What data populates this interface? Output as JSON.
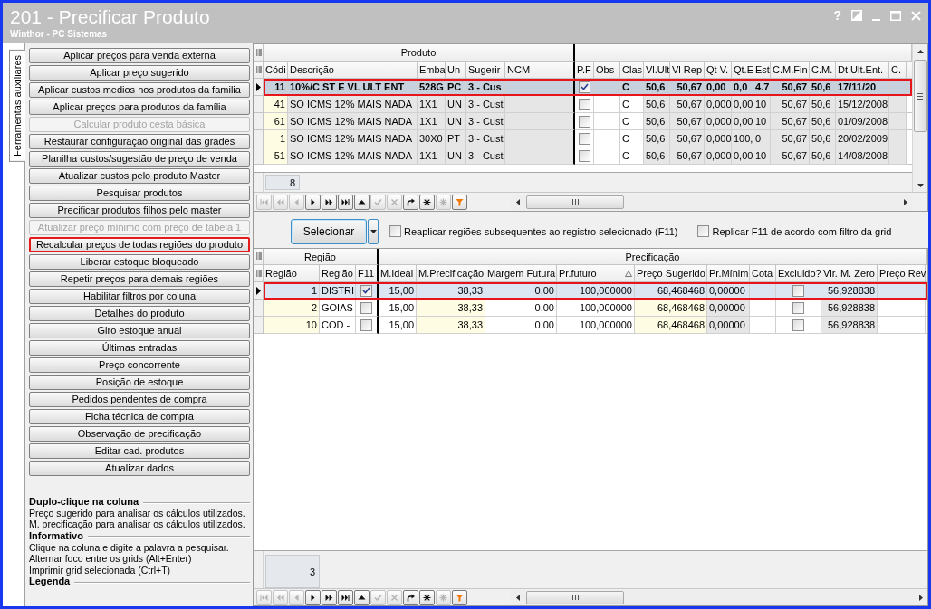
{
  "window": {
    "title": "201 - Precificar Produto",
    "subtitle": "Winthor - PC Sistemas",
    "help_label": "?"
  },
  "side_tab": {
    "label": "Ferramentas auxiliares",
    "selected": true
  },
  "actions": [
    {
      "label": "Aplicar preços para venda externa",
      "disabled": false,
      "highlighted": false
    },
    {
      "label": "Aplicar preço sugerido",
      "disabled": false,
      "highlighted": false
    },
    {
      "label": "Aplicar custos medios nos produtos da familia",
      "disabled": false,
      "highlighted": false
    },
    {
      "label": "Aplicar preços para produtos da família",
      "disabled": false,
      "highlighted": false
    },
    {
      "label": "Calcular produto cesta básica",
      "disabled": true,
      "highlighted": false
    },
    {
      "label": "Restaurar configuração original das grades",
      "disabled": false,
      "highlighted": false
    },
    {
      "label": "Planilha custos/sugestão de preço de venda",
      "disabled": false,
      "highlighted": false
    },
    {
      "label": "Atualizar custos pelo produto Master",
      "disabled": false,
      "highlighted": false
    },
    {
      "label": "Pesquisar produtos",
      "disabled": false,
      "highlighted": false
    },
    {
      "label": "Precificar produtos filhos pelo master",
      "disabled": false,
      "highlighted": false
    },
    {
      "label": "Atualizar preço mínimo com preço de tabela 1",
      "disabled": true,
      "highlighted": false
    },
    {
      "label": "Recalcular preços de todas regiões do produto",
      "disabled": false,
      "highlighted": true
    },
    {
      "label": "Liberar estoque bloqueado",
      "disabled": false,
      "highlighted": false
    },
    {
      "label": "Repetir preços para demais regiões",
      "disabled": false,
      "highlighted": false
    },
    {
      "label": "Habilitar filtros por coluna",
      "disabled": false,
      "highlighted": false
    },
    {
      "label": "Detalhes do produto",
      "disabled": false,
      "highlighted": false
    },
    {
      "label": "Giro estoque anual",
      "disabled": false,
      "highlighted": false
    },
    {
      "label": "Últimas entradas",
      "disabled": false,
      "highlighted": false
    },
    {
      "label": "Preço concorrente",
      "disabled": false,
      "highlighted": false
    },
    {
      "label": "Posição de estoque",
      "disabled": false,
      "highlighted": false
    },
    {
      "label": "Pedidos pendentes de compra",
      "disabled": false,
      "highlighted": false
    },
    {
      "label": "Ficha técnica de compra",
      "disabled": false,
      "highlighted": false
    },
    {
      "label": "Observação de precificação",
      "disabled": false,
      "highlighted": false
    },
    {
      "label": "Editar cad. produtos",
      "disabled": false,
      "highlighted": false
    },
    {
      "label": "Atualizar dados",
      "disabled": false,
      "highlighted": false
    }
  ],
  "hints": [
    {
      "heading": "Duplo-clique na coluna",
      "lines": [
        "Preço sugerido para analisar os cálculos utilizados.",
        "M. precificação para analisar os cálculos utilizados."
      ]
    },
    {
      "heading": "Informativo",
      "lines": [
        "Clique na coluna e digite a palavra a pesquisar.",
        "Alternar foco entre os grids (Alt+Enter)",
        "Imprimir grid selecionada (Ctrl+T)"
      ]
    },
    {
      "heading": "Legenda"
    }
  ],
  "product_grid": {
    "bands": [
      {
        "label": "Produto",
        "columns": [
          {
            "label": "Códi",
            "kind": "number"
          },
          {
            "label": "Descrição",
            "kind": "text"
          },
          {
            "label": "Emba",
            "kind": "text"
          },
          {
            "label": "Un",
            "kind": "text"
          },
          {
            "label": "Sugerir",
            "kind": "text"
          },
          {
            "label": "NCM",
            "kind": "text"
          }
        ]
      },
      {
        "columns": [
          {
            "label": "P.F",
            "kind": "check"
          },
          {
            "label": "Obs",
            "kind": "text"
          },
          {
            "label": "Clas",
            "kind": "text"
          },
          {
            "label": "Vl.Ult",
            "kind": "text"
          },
          {
            "label": "Vl Rep",
            "kind": "number"
          },
          {
            "label": "Qt V.",
            "kind": "text"
          },
          {
            "label": "Qt.E",
            "kind": "text"
          },
          {
            "label": "Est",
            "kind": "text"
          },
          {
            "label": "C.M.Fin",
            "kind": "number"
          },
          {
            "label": "C.M.",
            "kind": "text"
          },
          {
            "label": "Dt.Ult.Ent.",
            "kind": "text"
          },
          {
            "label": "C.",
            "kind": "text"
          }
        ]
      }
    ],
    "rows": [
      {
        "selected": true,
        "highlighted": true,
        "cells": [
          "11",
          "10%/C ST E VL ULT ENT",
          "528G",
          "PC",
          "3 - Cus",
          null,
          true,
          null,
          "C",
          "50,6",
          "50,67",
          "0,00",
          "0,0",
          "4.7",
          "50,67",
          "50,6",
          "17/11/20",
          null
        ]
      },
      {
        "selected": false,
        "highlighted": false,
        "cells": [
          "41",
          "SO ICMS 12% MAIS NADA",
          "1X1",
          "UN",
          "3 - Cust",
          null,
          false,
          null,
          "C",
          "50,6",
          "50,67",
          "0,000",
          "0,00",
          "10",
          "50,67",
          "50,6",
          "15/12/2008",
          null
        ]
      },
      {
        "selected": false,
        "highlighted": false,
        "cells": [
          "61",
          "SO ICMS 12% MAIS NADA",
          "1X1",
          "UN",
          "3 - Cust",
          null,
          false,
          null,
          "C",
          "50,6",
          "50,67",
          "0,000",
          "0,00",
          "10",
          "50,67",
          "50,6",
          "01/09/2008",
          null
        ]
      },
      {
        "selected": false,
        "highlighted": false,
        "cells": [
          "1",
          "SO ICMS 12% MAIS NADA",
          "30X0",
          "PT",
          "3 - Cust",
          null,
          false,
          null,
          "C",
          "50,6",
          "50,67",
          "0,000",
          "100,",
          "0",
          "50,67",
          "50,6",
          "20/02/2009",
          null
        ]
      },
      {
        "selected": false,
        "highlighted": false,
        "cells": [
          "51",
          "SO ICMS 12% MAIS NADA",
          "1X1",
          "UN",
          "3 - Cust",
          null,
          false,
          null,
          "C",
          "50,6",
          "50,67",
          "0,000",
          "0,00",
          "10",
          "50,67",
          "50,6",
          "14/08/2008",
          null
        ]
      }
    ],
    "record_count": "8",
    "navigator": [
      {
        "disabled": true
      },
      {
        "disabled": true
      },
      {
        "disabled": true
      },
      {
        "disabled": false
      },
      {
        "disabled": false
      },
      {
        "disabled": false
      },
      {
        "disabled": false
      },
      {
        "disabled": true
      },
      {
        "disabled": true
      },
      {
        "disabled": false
      },
      {
        "disabled": false
      },
      {
        "disabled": true
      },
      {
        "disabled": false
      }
    ]
  },
  "toolbar": {
    "select_button": "Selecionar",
    "options": [
      {
        "label": "Reaplicar regiões subsequentes ao registro selecionado (F11)",
        "checked": false
      },
      {
        "label": "Replicar F11 de acordo com filtro da grid",
        "checked": false
      }
    ]
  },
  "region_grid": {
    "bands": [
      {
        "label": "Região",
        "columns": [
          {
            "label": "Região",
            "kind": "number"
          },
          {
            "label": "Região",
            "kind": "text"
          },
          {
            "label": "F11",
            "kind": "check"
          }
        ]
      },
      {
        "label": "Precificação",
        "columns": [
          {
            "label": "M.Ideal",
            "kind": "number"
          },
          {
            "label": "M.Precificação",
            "kind": "number"
          },
          {
            "label": "Margem Futura",
            "kind": "number"
          },
          {
            "label": "Pr.futuro",
            "kind": "number",
            "sorted": true
          },
          {
            "label": "Preço Sugerido",
            "kind": "number"
          },
          {
            "label": "Pr.Mínim",
            "kind": "text"
          },
          {
            "label": "Cota",
            "kind": "text"
          },
          {
            "label": "Excluido?",
            "kind": "check"
          },
          {
            "label": "Vlr. M. Zero",
            "kind": "number"
          },
          {
            "label": "Preço Rev",
            "kind": "text"
          }
        ]
      }
    ],
    "rows": [
      {
        "selected": true,
        "highlighted": true,
        "cells": [
          "1",
          "DISTRI",
          true,
          "15,00",
          "38,33",
          "0,00",
          "100,000000",
          "68,468468",
          "0,00000",
          null,
          false,
          "56,928838",
          null
        ]
      },
      {
        "selected": false,
        "highlighted": false,
        "cells": [
          "2",
          "GOIAS",
          false,
          "15,00",
          "38,33",
          "0,00",
          "100,000000",
          "68,468468",
          "0,00000",
          null,
          false,
          "56,928838",
          null
        ]
      },
      {
        "selected": false,
        "highlighted": false,
        "cells": [
          "10",
          "COD -",
          false,
          "15,00",
          "38,33",
          "0,00",
          "100,000000",
          "68,468468",
          "0,00000",
          null,
          false,
          "56,928838",
          null
        ]
      }
    ],
    "record_count": "3",
    "navigator": [
      {
        "disabled": true
      },
      {
        "disabled": true
      },
      {
        "disabled": true
      },
      {
        "disabled": false
      },
      {
        "disabled": false
      },
      {
        "disabled": false
      },
      {
        "disabled": false
      },
      {
        "disabled": true
      },
      {
        "disabled": true
      },
      {
        "disabled": false
      },
      {
        "disabled": false
      },
      {
        "disabled": true
      },
      {
        "disabled": false
      }
    ]
  }
}
